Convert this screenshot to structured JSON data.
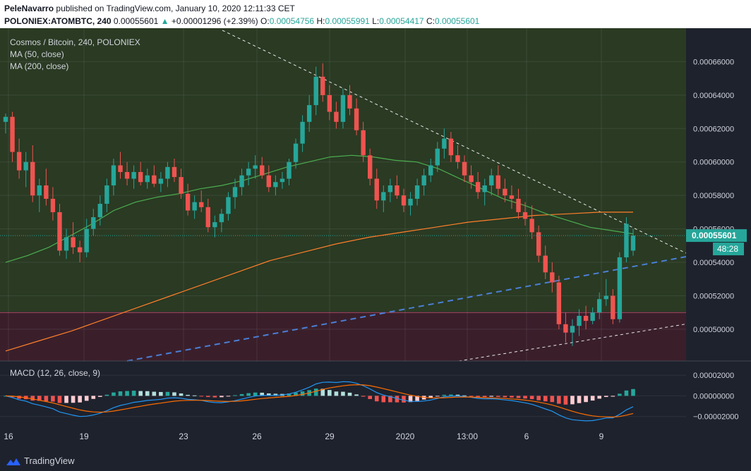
{
  "header": {
    "author": "PeleNavarro",
    "published_text": "published on TradingView.com, January 10, 2020 12:11:33 CET",
    "symbol": "POLONIEX:ATOMBTC, 240",
    "last": "0.00055601",
    "change": "+0.00001296 (+2.39%)",
    "o_label": "O:",
    "o": "0.00054756",
    "h_label": "H:",
    "h": "0.00055991",
    "l_label": "L:",
    "l": "0.00054417",
    "c_label": "C:",
    "c": "0.00055601"
  },
  "legend": {
    "title": "Cosmos / Bitcoin, 240, POLONIEX",
    "ma1": "MA (50, close)",
    "ma2": "MA (200, close)",
    "macd": "MACD (12, 26, close, 9)"
  },
  "price_tag": {
    "value": "0.00055601",
    "countdown": "48:28"
  },
  "footer": {
    "brand": "TradingView"
  },
  "colors": {
    "up": "#26a69a",
    "down": "#ef5350",
    "ma50": "#4caf50",
    "ma200": "#ff7f2a",
    "support_zone": "#3a1f2b",
    "main_bg": "#2a3a23",
    "macd_line": "#2196f3",
    "signal_line": "#ff6d00"
  },
  "chart_data": {
    "type": "candlestick",
    "ylim": [
      0.000481,
      0.00068
    ],
    "y_ticks": [
      0.00066,
      0.00064,
      0.00062,
      0.0006,
      0.00058,
      0.00056,
      0.00054,
      0.00052,
      0.0005
    ],
    "y_tick_labels": [
      "0.00066000",
      "0.00064000",
      "0.00062000",
      "0.00060000",
      "0.00058000",
      "0.00056000",
      "0.00054000",
      "0.00052000",
      "0.00050000"
    ],
    "x_labels": [
      "16",
      "19",
      "23",
      "26",
      "29",
      "2020",
      "13:00",
      "6",
      "9"
    ],
    "candles": [
      [
        0.000624,
        0.000629,
        0.000617,
        0.000627
      ],
      [
        0.000627,
        0.00063,
        0.0006,
        0.000606
      ],
      [
        0.000606,
        0.000614,
        0.00059,
        0.000595
      ],
      [
        0.000595,
        0.000606,
        0.000585,
        0.0006
      ],
      [
        0.0006,
        0.00061,
        0.000576,
        0.00058
      ],
      [
        0.00058,
        0.00059,
        0.00057,
        0.000586
      ],
      [
        0.000586,
        0.000596,
        0.000574,
        0.000578
      ],
      [
        0.000578,
        0.000585,
        0.000565,
        0.00057
      ],
      [
        0.00057,
        0.000575,
        0.000544,
        0.000547
      ],
      [
        0.000547,
        0.00056,
        0.000542,
        0.000555
      ],
      [
        0.000555,
        0.000564,
        0.000545,
        0.000549
      ],
      [
        0.000549,
        0.000553,
        0.00054,
        0.000546
      ],
      [
        0.000546,
        0.000566,
        0.000543,
        0.00056
      ],
      [
        0.00056,
        0.000572,
        0.000556,
        0.000567
      ],
      [
        0.000567,
        0.00058,
        0.000562,
        0.000575
      ],
      [
        0.000575,
        0.00059,
        0.00057,
        0.000586
      ],
      [
        0.000586,
        0.000602,
        0.00058,
        0.000598
      ],
      [
        0.000598,
        0.000606,
        0.00059,
        0.000594
      ],
      [
        0.000594,
        0.0006,
        0.000586,
        0.00059
      ],
      [
        0.00059,
        0.000598,
        0.000584,
        0.000594
      ],
      [
        0.000594,
        0.0006,
        0.000586,
        0.000588
      ],
      [
        0.000588,
        0.000596,
        0.000584,
        0.000592
      ],
      [
        0.000592,
        0.000598,
        0.000585,
        0.000587
      ],
      [
        0.000587,
        0.000594,
        0.000582,
        0.00059
      ],
      [
        0.00059,
        0.0006,
        0.000585,
        0.000597
      ],
      [
        0.000597,
        0.000602,
        0.000588,
        0.000591
      ],
      [
        0.000591,
        0.000596,
        0.000578,
        0.000581
      ],
      [
        0.000581,
        0.000587,
        0.000568,
        0.000571
      ],
      [
        0.000571,
        0.00058,
        0.000566,
        0.000576
      ],
      [
        0.000576,
        0.000583,
        0.00057,
        0.000573
      ],
      [
        0.000573,
        0.000578,
        0.000558,
        0.000561
      ],
      [
        0.000561,
        0.000568,
        0.000555,
        0.000564
      ],
      [
        0.000564,
        0.000572,
        0.000558,
        0.000569
      ],
      [
        0.000569,
        0.000582,
        0.000565,
        0.000579
      ],
      [
        0.000579,
        0.00059,
        0.000572,
        0.000585
      ],
      [
        0.000585,
        0.000596,
        0.00058,
        0.000592
      ],
      [
        0.000592,
        0.0006,
        0.000586,
        0.000596
      ],
      [
        0.000596,
        0.000604,
        0.00059,
        0.000598
      ],
      [
        0.000598,
        0.000603,
        0.00059,
        0.000592
      ],
      [
        0.000592,
        0.000598,
        0.000582,
        0.000585
      ],
      [
        0.000585,
        0.000592,
        0.00058,
        0.000588
      ],
      [
        0.000588,
        0.000594,
        0.000584,
        0.00059
      ],
      [
        0.00059,
        0.000602,
        0.000586,
        0.0006
      ],
      [
        0.0006,
        0.000614,
        0.000596,
        0.000611
      ],
      [
        0.000611,
        0.000628,
        0.000606,
        0.000624
      ],
      [
        0.000624,
        0.00064,
        0.000618,
        0.000634
      ],
      [
        0.000634,
        0.000657,
        0.000628,
        0.000651
      ],
      [
        0.000651,
        0.000659,
        0.000636,
        0.00064
      ],
      [
        0.00064,
        0.000646,
        0.000625,
        0.00063
      ],
      [
        0.00063,
        0.000636,
        0.00062,
        0.000624
      ],
      [
        0.000624,
        0.000644,
        0.00062,
        0.00064
      ],
      [
        0.00064,
        0.000646,
        0.000628,
        0.000632
      ],
      [
        0.000632,
        0.000638,
        0.000616,
        0.000619
      ],
      [
        0.000619,
        0.000624,
        0.0006,
        0.000604
      ],
      [
        0.000604,
        0.000608,
        0.000586,
        0.00059
      ],
      [
        0.00059,
        0.000596,
        0.000572,
        0.000577
      ],
      [
        0.000577,
        0.000586,
        0.00057,
        0.000582
      ],
      [
        0.000582,
        0.00059,
        0.000576,
        0.000586
      ],
      [
        0.000586,
        0.000592,
        0.000578,
        0.00058
      ],
      [
        0.00058,
        0.000584,
        0.00057,
        0.000574
      ],
      [
        0.000574,
        0.000582,
        0.000568,
        0.000578
      ],
      [
        0.000578,
        0.00059,
        0.000574,
        0.000586
      ],
      [
        0.000586,
        0.000596,
        0.00058,
        0.000592
      ],
      [
        0.000592,
        0.000602,
        0.000588,
        0.000598
      ],
      [
        0.000598,
        0.000612,
        0.000594,
        0.000608
      ],
      [
        0.000608,
        0.00062,
        0.000602,
        0.000614
      ],
      [
        0.000614,
        0.000618,
        0.0006,
        0.000604
      ],
      [
        0.000604,
        0.00061,
        0.000596,
        0.0006
      ],
      [
        0.0006,
        0.000604,
        0.000588,
        0.000592
      ],
      [
        0.000592,
        0.000598,
        0.000584,
        0.000588
      ],
      [
        0.000588,
        0.000594,
        0.000578,
        0.000582
      ],
      [
        0.000582,
        0.00059,
        0.000574,
        0.000586
      ],
      [
        0.000586,
        0.000596,
        0.00058,
        0.000592
      ],
      [
        0.000592,
        0.000598,
        0.00058,
        0.000584
      ],
      [
        0.000584,
        0.00059,
        0.000576,
        0.00058
      ],
      [
        0.00058,
        0.000586,
        0.000572,
        0.000578
      ],
      [
        0.000578,
        0.000584,
        0.000566,
        0.00057
      ],
      [
        0.00057,
        0.000576,
        0.000562,
        0.000566
      ],
      [
        0.000566,
        0.000574,
        0.000554,
        0.000558
      ],
      [
        0.000558,
        0.000562,
        0.00054,
        0.000544
      ],
      [
        0.000544,
        0.00055,
        0.00053,
        0.000534
      ],
      [
        0.000534,
        0.00054,
        0.000522,
        0.000528
      ],
      [
        0.000528,
        0.000532,
        0.0005,
        0.000503
      ],
      [
        0.000503,
        0.00051,
        0.000492,
        0.000498
      ],
      [
        0.000498,
        0.000506,
        0.00049,
        0.000502
      ],
      [
        0.000502,
        0.000512,
        0.000496,
        0.000508
      ],
      [
        0.000508,
        0.000514,
        0.0005,
        0.000505
      ],
      [
        0.000505,
        0.000513,
        0.000503,
        0.00051
      ],
      [
        0.00051,
        0.000522,
        0.000506,
        0.000518
      ],
      [
        0.000518,
        0.00053,
        0.000514,
        0.00052
      ],
      [
        0.00052,
        0.000524,
        0.000503,
        0.000506
      ],
      [
        0.000506,
        0.000546,
        0.000504,
        0.000543
      ],
      [
        0.000543,
        0.000567,
        0.00054,
        0.000563
      ],
      [
        0.000547,
        0.00056,
        0.000544,
        0.000556
      ]
    ],
    "ma50": [
      0.00054,
      0.000544,
      0.000549,
      0.000556,
      0.000563,
      0.000571,
      0.000576,
      0.000579,
      0.000581,
      0.000584,
      0.000586,
      0.000589,
      0.000593,
      0.000597,
      0.0006,
      0.000603,
      0.000604,
      0.000603,
      0.000601,
      0.0006,
      0.000596,
      0.00059,
      0.000584,
      0.000578,
      0.000574,
      0.000569,
      0.000565,
      0.000561,
      0.000559,
      0.000557
    ],
    "ma200": [
      0.000487,
      0.000493,
      0.000499,
      0.000506,
      0.000513,
      0.00052,
      0.000527,
      0.000534,
      0.000541,
      0.000546,
      0.000551,
      0.000555,
      0.000558,
      0.000561,
      0.000564,
      0.000566,
      0.000568,
      0.000569,
      0.00057,
      0.00057
    ],
    "macd": {
      "ylim": [
        -2.7e-05,
        3.3e-05
      ],
      "y_tick_labels": [
        "0.00002000",
        "0.00000000",
        "−0.00002000"
      ],
      "y_ticks": [
        2e-05,
        0.0,
        -2e-05
      ]
    }
  }
}
